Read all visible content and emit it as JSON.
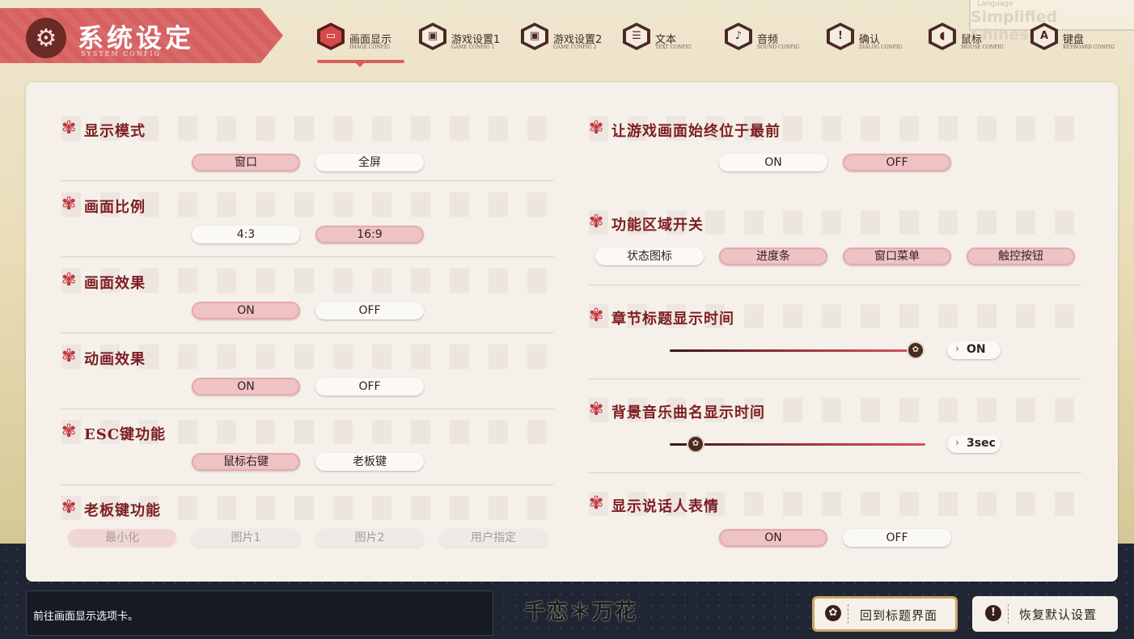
{
  "language": {
    "label": "Language",
    "value": "Simplified Chinese"
  },
  "header": {
    "title": "系统设定",
    "subtitle": "SYSTEM CONFIG",
    "icon": "gear-icon"
  },
  "tabs": [
    {
      "label": "画面显示",
      "sub": "IMAGE CONFIG",
      "icon": "monitor-icon",
      "active": true
    },
    {
      "label": "游戏设置1",
      "sub": "GAME CONFIG 1",
      "icon": "window-icon"
    },
    {
      "label": "游戏设置2",
      "sub": "GAME CONFIG 2",
      "icon": "window-icon"
    },
    {
      "label": "文本",
      "sub": "TEXT CONFIG",
      "icon": "list-icon"
    },
    {
      "label": "音频",
      "sub": "SOUND CONFIG",
      "icon": "speaker-icon"
    },
    {
      "label": "确认",
      "sub": "DIALOG CONFIG",
      "icon": "exclamation-icon"
    },
    {
      "label": "鼠标",
      "sub": "MOUSE CONFIG",
      "icon": "mouse-icon"
    },
    {
      "label": "键盘",
      "sub": "KEYBOARD CONFIG",
      "icon": "keyboard-icon"
    }
  ],
  "left": {
    "display_mode": {
      "title": "显示模式",
      "options": [
        "窗口",
        "全屏"
      ],
      "selected": "窗口"
    },
    "aspect_ratio": {
      "title": "画面比例",
      "options": [
        "4:3",
        "16:9"
      ],
      "selected": "16:9"
    },
    "screen_effect": {
      "title": "画面效果",
      "options": [
        "ON",
        "OFF"
      ],
      "selected": "ON"
    },
    "animation_effect": {
      "title": "动画效果",
      "options": [
        "ON",
        "OFF"
      ],
      "selected": "ON"
    },
    "esc_function": {
      "title": "ESC键功能",
      "options": [
        "鼠标右键",
        "老板键"
      ],
      "selected": "鼠标右键"
    },
    "boss_key": {
      "title": "老板键功能",
      "options": [
        "最小化",
        "图片1",
        "图片2",
        "用户指定"
      ],
      "selected": "最小化",
      "disabled": true
    }
  },
  "right": {
    "always_on_top": {
      "title": "让游戏画面始终位于最前",
      "options": [
        "ON",
        "OFF"
      ],
      "selected": "OFF"
    },
    "function_area": {
      "title": "功能区域开关",
      "options": [
        "状态图标",
        "进度条",
        "窗口菜单",
        "触控按钮"
      ],
      "selected": [
        "进度条",
        "窗口菜单",
        "触控按钮"
      ]
    },
    "chapter_title_time": {
      "title": "章节标题显示时间",
      "value_label": "ON",
      "level": 1.0
    },
    "bgm_title_time": {
      "title": "背景音乐曲名显示时间",
      "value_label": "3sec",
      "level": 0.1
    },
    "speaker_expression": {
      "title": "显示说话人表情",
      "options": [
        "ON",
        "OFF"
      ],
      "selected": "ON"
    }
  },
  "footer": {
    "status_text": "前往画面显示选项卡。",
    "logo": "千恋＊万花",
    "back_title_label": "回到标题界面",
    "reset_label": "恢复默认设置"
  },
  "colors": {
    "accent": "#dc5c5c",
    "selected_fill": "#efc2c3",
    "title_text": "#7c1e22"
  }
}
